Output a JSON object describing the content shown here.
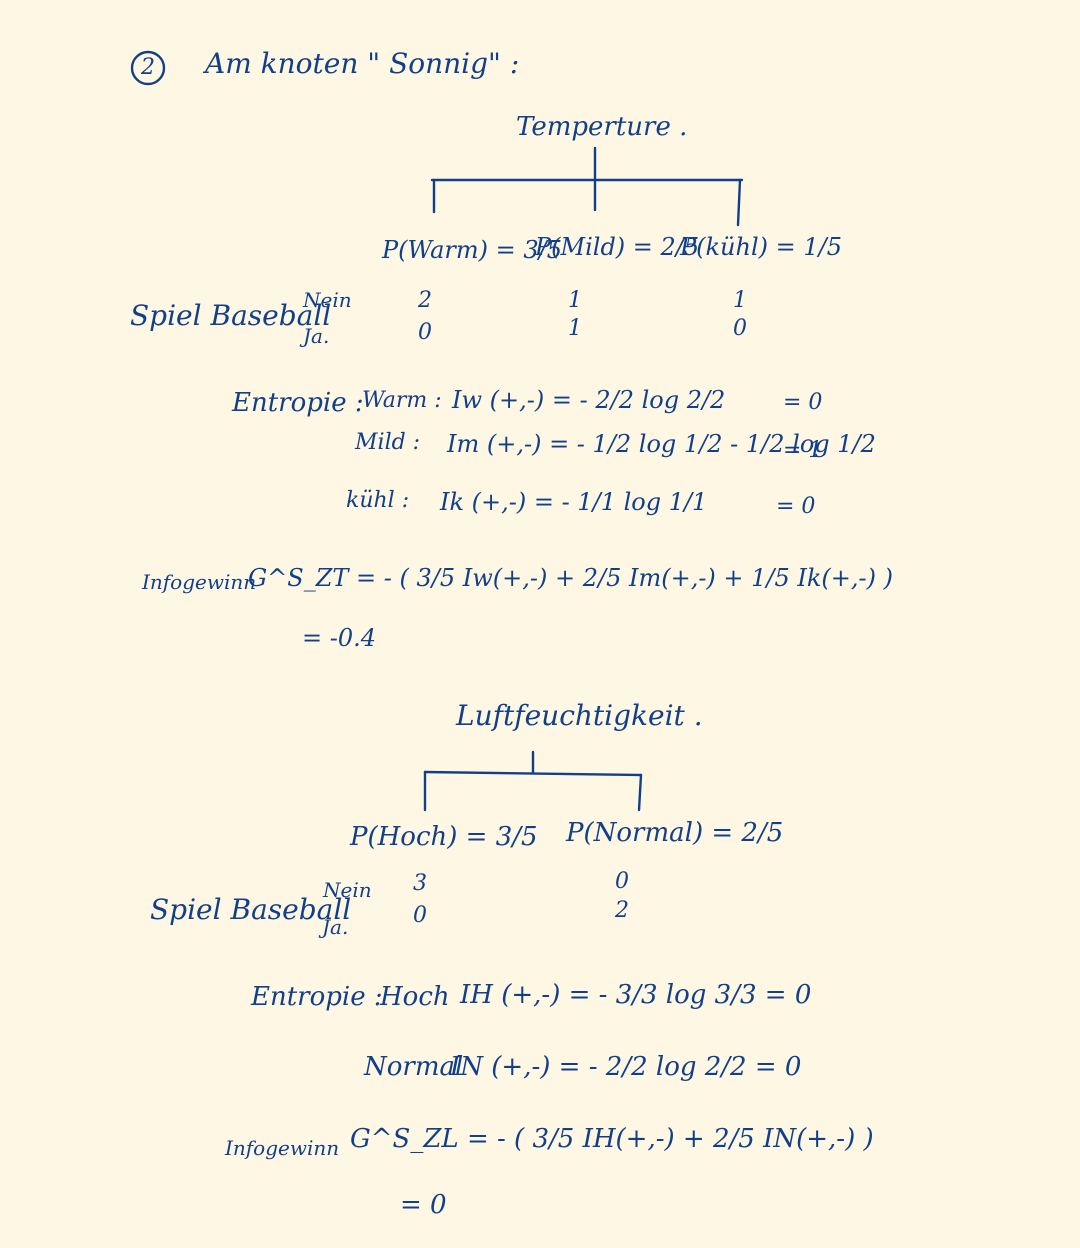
{
  "step": "2",
  "heading": "Am knoten \" Sonnig\" :",
  "temperature": {
    "title": "Temperture .",
    "branches": [
      "P(Warm) = 3/5",
      "P(Mild) = 2/5",
      "P(kühl) = 1/5"
    ],
    "row_label": "Spiel Baseball",
    "class_labels": [
      "Nein",
      "Ja."
    ],
    "counts": [
      [
        "2",
        "1",
        "1"
      ],
      [
        "0",
        "1",
        "0"
      ]
    ],
    "entropy_label": "Entropie :",
    "entropy_lines": [
      {
        "name": "Warm :",
        "formula": "Iw (+,-) = - 2/2 log 2/2",
        "result": "= 0"
      },
      {
        "name": "Mild :",
        "formula": "Im (+,-) = - 1/2 log 1/2 - 1/2 log 1/2",
        "result": "= 1"
      },
      {
        "name": "kühl :",
        "formula": "Ik (+,-) = - 1/1 log 1/1",
        "result": "= 0"
      }
    ],
    "gain_label": "Infogewinn",
    "gain_formula": "G^S_ZT = - ( 3/5 Iw(+,-) + 2/5 Im(+,-) + 1/5 Ik(+,-) )",
    "gain_result": "= -0.4"
  },
  "humidity": {
    "title": "Luftfeuchtigkeit .",
    "branches": [
      "P(Hoch) = 3/5",
      "P(Normal) = 2/5"
    ],
    "row_label": "Spiel Baseball",
    "class_labels": [
      "Nein",
      "Ja."
    ],
    "counts": [
      [
        "3",
        "0"
      ],
      [
        "0",
        "2"
      ]
    ],
    "entropy_label": "Entropie :",
    "entropy_lines": [
      {
        "name": "Hoch",
        "formula": "IH (+,-) = - 3/3 log 3/3 = 0"
      },
      {
        "name": "Normal",
        "formula": "IN (+,-) = - 2/2 log 2/2 = 0"
      }
    ],
    "gain_label": "Infogewinn",
    "gain_formula": "G^S_ZL = - ( 3/5 IH(+,-) + 2/5 IN(+,-) )",
    "gain_result": "= 0"
  }
}
